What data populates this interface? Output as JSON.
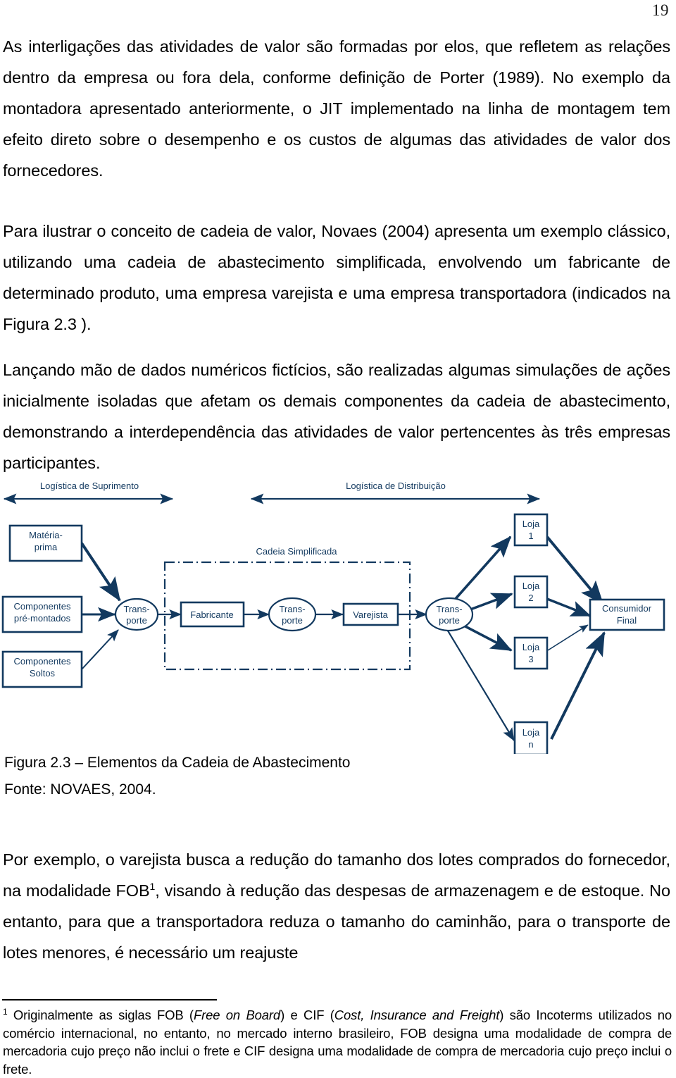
{
  "page": {
    "number": "19"
  },
  "colors": {
    "diagram_stroke": "#12395f",
    "text": "#000000"
  },
  "paragraphs": {
    "p1": "As interligações das atividades de valor são formadas por elos, que refletem as relações dentro da empresa ou fora dela, conforme definição de Porter (1989). No exemplo da montadora apresentado anteriormente, o JIT implementado na linha de montagem tem efeito direto sobre o desempenho e os custos de algumas das atividades de valor dos fornecedores.",
    "p2": "Para ilustrar o conceito de cadeia de valor, Novaes (2004) apresenta um exemplo clássico, utilizando uma cadeia de abastecimento simplificada, envolvendo um fabricante de determinado produto, uma empresa varejista e uma empresa transportadora (indicados na Figura 2.3 ).",
    "p3": "Lançando mão de dados numéricos fictícios, são realizadas algumas simulações de ações inicialmente isoladas que afetam os demais componentes da cadeia de abastecimento, demonstrando a interdependência das atividades de valor pertencentes às três empresas participantes.",
    "p4_part1": "Por exemplo, o varejista busca a redução do tamanho dos lotes comprados do fornecedor, na modalidade FOB",
    "p4_sup": "1",
    "p4_part2": ", visando à redução das despesas de armazenagem e de estoque. No entanto, para que a transportadora reduza o tamanho do caminhão, para o transporte de lotes menores, é necessário um reajuste"
  },
  "figure": {
    "caption": "Figura 2.3 – Elementos da Cadeia de Abastecimento",
    "source": "Fonte: NOVAES, 2004.",
    "axis_supply": "Logística de Suprimento",
    "axis_distribution": "Logística de Distribuição",
    "chain_label": "Cadeia Simplificada",
    "nodes": {
      "materia_prima_line1": "Matéria-",
      "materia_prima_line2": "prima",
      "componentes_pre_line1": "Componentes",
      "componentes_pre_line2": "pré-montados",
      "componentes_soltos_line1": "Componentes",
      "componentes_soltos_line2": "Soltos",
      "transporte1_line1": "Trans-",
      "transporte1_line2": "porte",
      "fabricante": "Fabricante",
      "transporte2_line1": "Trans-",
      "transporte2_line2": "porte",
      "varejista": "Varejista",
      "transporte3_line1": "Trans-",
      "transporte3_line2": "porte",
      "loja1_line1": "Loja",
      "loja1_line2": "1",
      "loja2_line1": "Loja",
      "loja2_line2": "2",
      "loja3_line1": "Loja",
      "loja3_line2": "3",
      "lojan_line1": "Loja",
      "lojan_line2": "n",
      "consumidor_line1": "Consumidor",
      "consumidor_line2": "Final"
    }
  },
  "footnote": {
    "marker": "1",
    "text_a": " Originalmente as siglas FOB (",
    "italic_a": "Free on Board",
    "text_b": ") e CIF (",
    "italic_b": "Cost, Insurance and Freight",
    "text_c": ") são Incoterms utilizados no comércio internacional, no entanto, no mercado interno brasileiro, FOB designa uma modalidade de compra de mercadoria cujo preço não inclui o frete e CIF designa uma modalidade de compra de mercadoria cujo preço inclui o frete."
  }
}
